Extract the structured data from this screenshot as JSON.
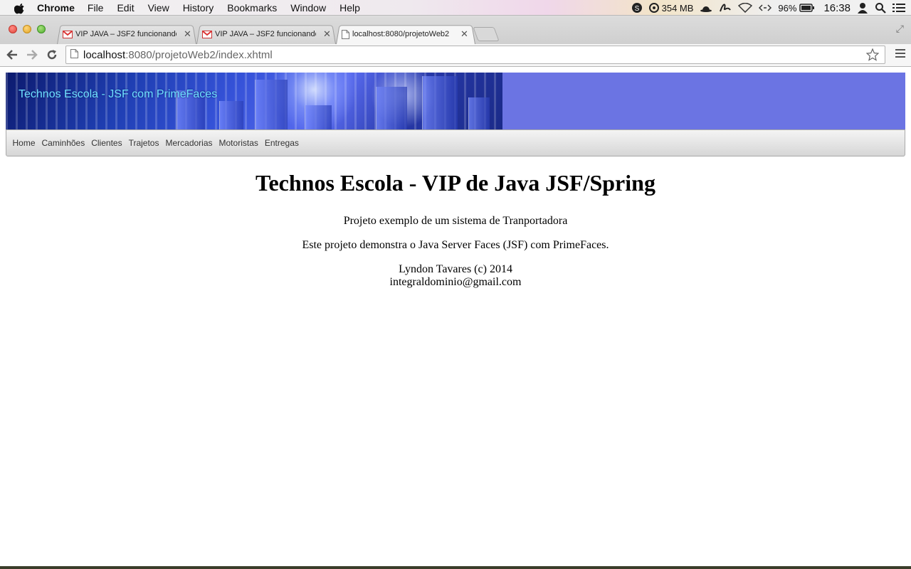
{
  "menubar": {
    "app_name": "Chrome",
    "items": [
      "File",
      "Edit",
      "View",
      "History",
      "Bookmarks",
      "Window",
      "Help"
    ],
    "memory": "354 MB",
    "battery": "96%",
    "clock": "16:38"
  },
  "tabs": [
    {
      "label": "VIP JAVA – JSF2 funcionando",
      "icon": "gmail-icon"
    },
    {
      "label": "VIP JAVA – JSF2 funcionando",
      "icon": "gmail-icon"
    },
    {
      "label": "localhost:8080/projetoWeb2",
      "icon": "page-icon"
    }
  ],
  "address": {
    "host": "localhost",
    "rest": ":8080/projetoWeb2/index.xhtml"
  },
  "page": {
    "banner_title": "Technos Escola - JSF com PrimeFaces",
    "nav": [
      "Home",
      "Caminhões",
      "Clientes",
      "Trajetos",
      "Mercadorias",
      "Motoristas",
      "Entregas"
    ],
    "heading": "Technos Escola - VIP de Java JSF/Spring",
    "line1": "Projeto exemplo de um sistema de Tranportadora",
    "line2": "Este projeto demonstra o Java Server Faces (JSF) com PrimeFaces.",
    "author": "Lyndon Tavares (c) 2014",
    "email": "integraldominio@gmail.com"
  },
  "colors": {
    "banner_bg": "#6b74e3",
    "banner_title": "#6fe0ff"
  }
}
